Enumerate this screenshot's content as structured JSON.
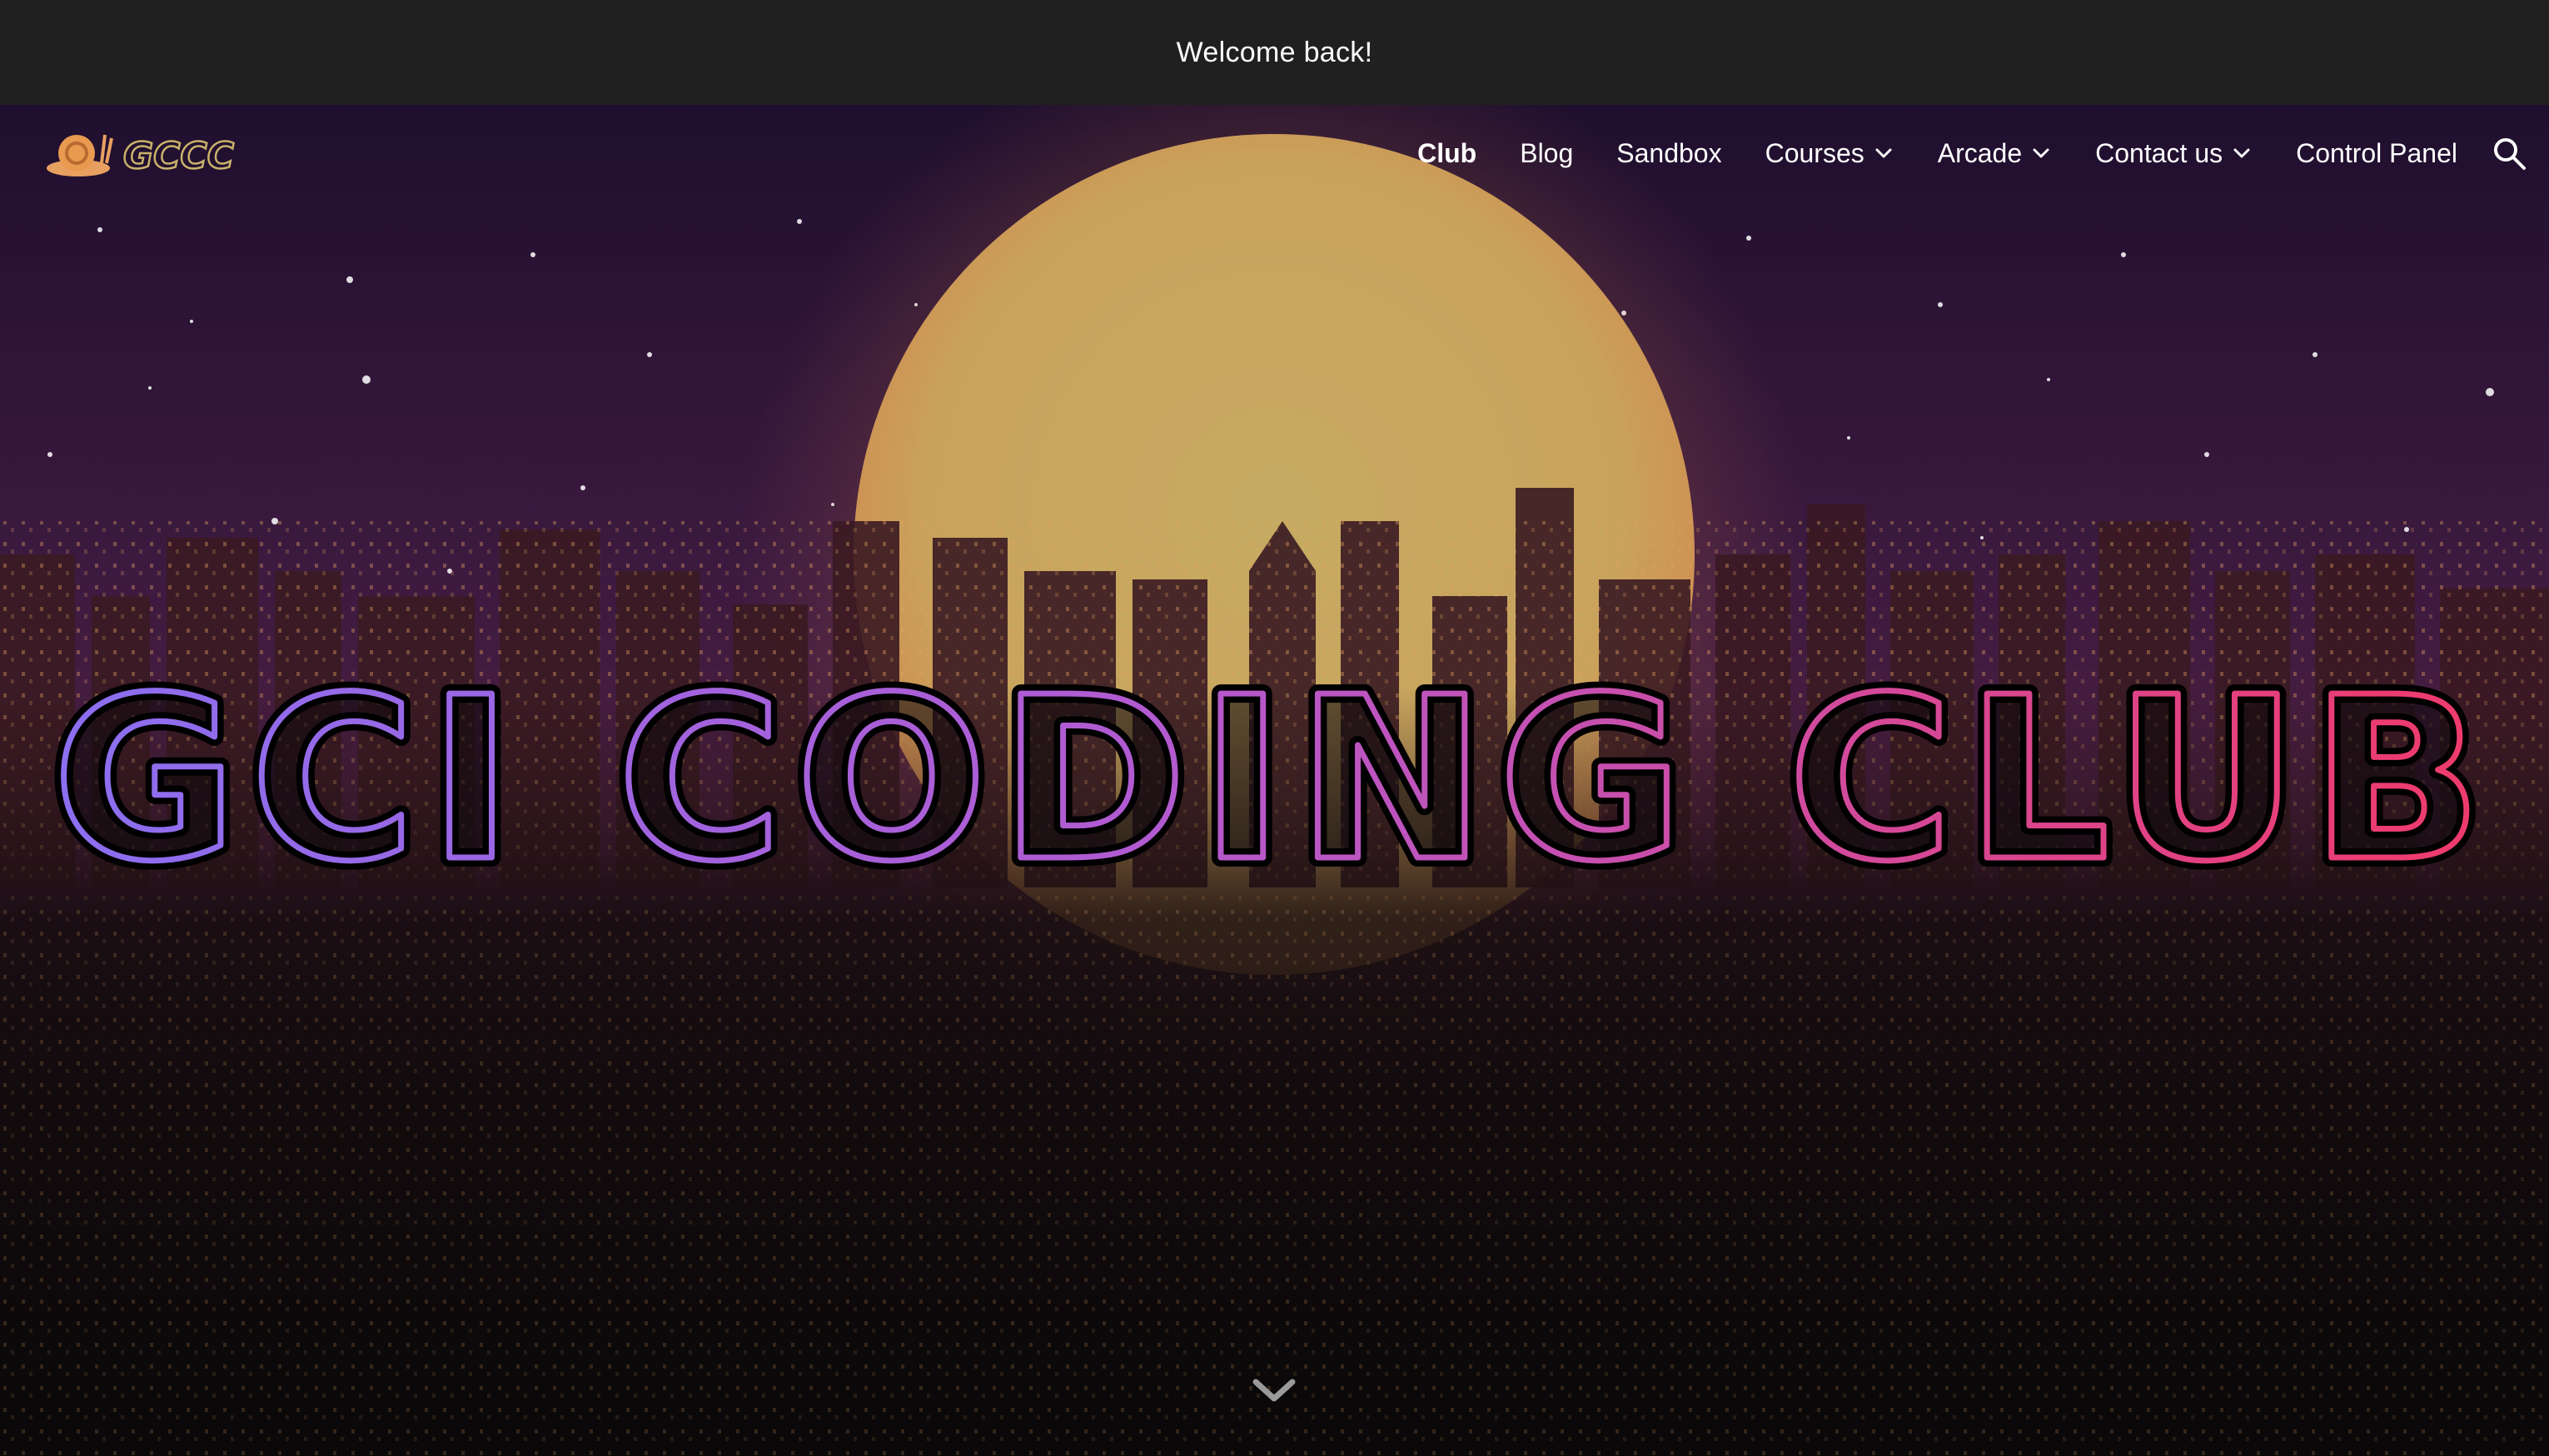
{
  "announcement": {
    "text": "Welcome back!"
  },
  "nav": {
    "logo_text": "GCCC",
    "items": [
      {
        "label": "Club",
        "active": true,
        "dropdown": false
      },
      {
        "label": "Blog",
        "active": false,
        "dropdown": false
      },
      {
        "label": "Sandbox",
        "active": false,
        "dropdown": false
      },
      {
        "label": "Courses",
        "active": false,
        "dropdown": true
      },
      {
        "label": "Arcade",
        "active": false,
        "dropdown": true
      },
      {
        "label": "Contact us",
        "active": false,
        "dropdown": true
      },
      {
        "label": "Control Panel",
        "active": false,
        "dropdown": false
      }
    ],
    "search_icon": "search-icon"
  },
  "hero": {
    "title": "GCI CODING CLUB",
    "scroll_icon": "chevron-down-icon",
    "colors": {
      "sky_top": "#221033",
      "sky_mid": "#4a1f4a",
      "sun": "#d2b05e",
      "title_start": "#8b6ff0",
      "title_end": "#f03a6a"
    }
  }
}
